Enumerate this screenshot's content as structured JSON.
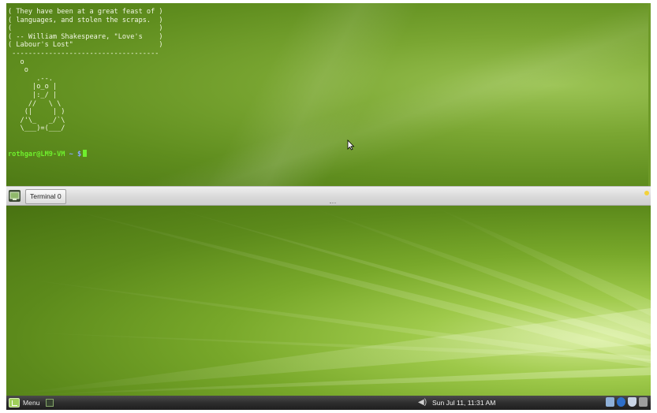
{
  "terminal": {
    "fortune_lines": [
      "( They have been at a great feast of )",
      "( languages, and stolen the scraps.  )",
      "(                                    )",
      "( -- William Shakespeare, \"Love's    )",
      "( Labour's Lost\"                     )",
      " ------------------------------------",
      "   o",
      "    o",
      "       .--.",
      "      |o_o |",
      "      |:_/ |",
      "     //   \\ \\",
      "    (|     | )",
      "   /'\\_   _/`\\",
      "   \\___)=(___/"
    ],
    "prompt_user": "rothgar@LM9-VM",
    "prompt_path": "~ $"
  },
  "mid_panel": {
    "task_button_label": "Terminal 0"
  },
  "bottom_panel": {
    "menu_label": "Menu",
    "clock": "Sun Jul 11, 11:31 AM"
  },
  "colors": {
    "wallpaper_green": "#5d8c1c",
    "prompt_green": "#6ff02d",
    "prompt_blue": "#8aa8ff"
  }
}
